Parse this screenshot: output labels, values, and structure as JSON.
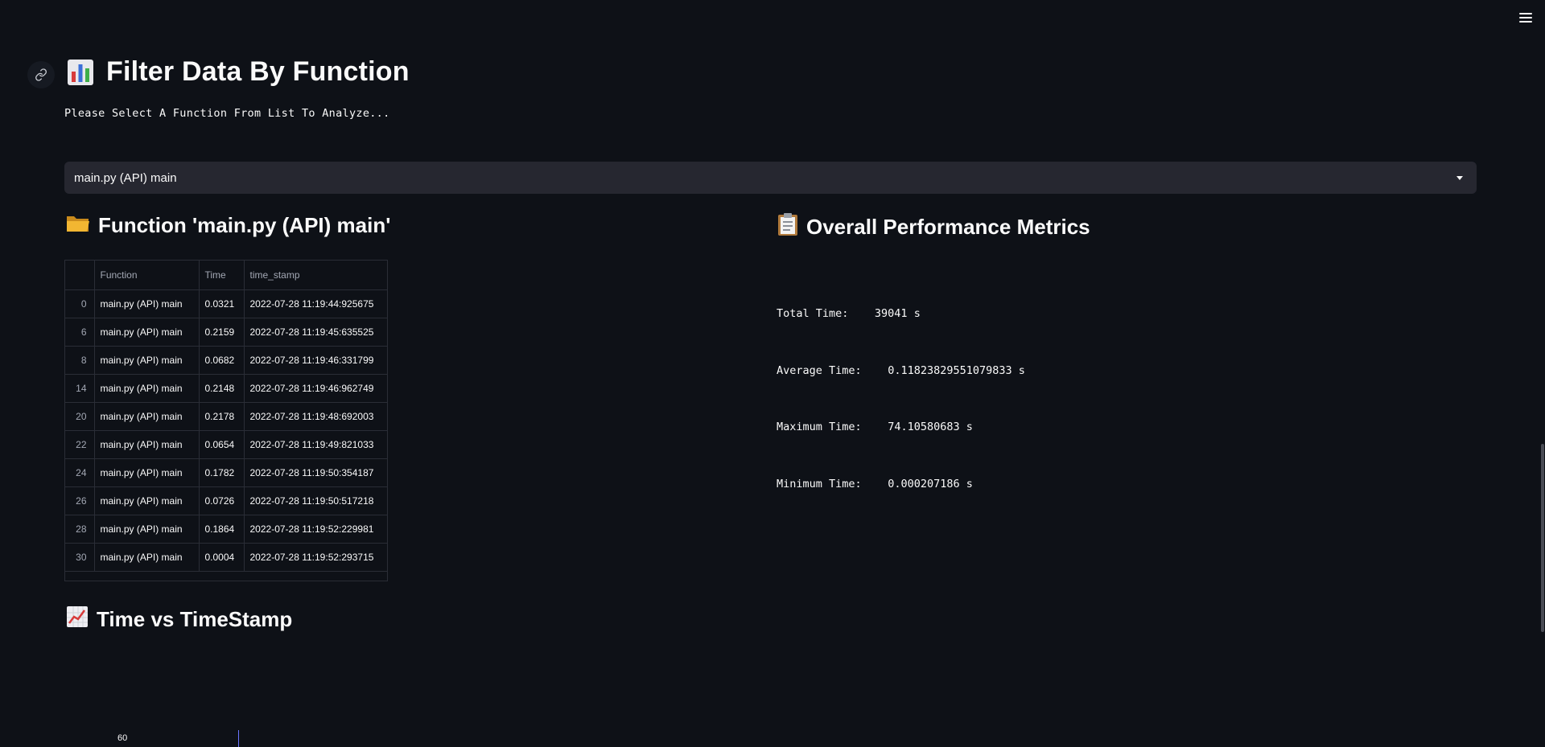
{
  "header": {
    "title": "Filter Data By Function",
    "title_emoji": "📊",
    "subtitle": "Please Select A Function From List To Analyze..."
  },
  "select": {
    "value": "main.py (API) main"
  },
  "function_section": {
    "emoji": "📂",
    "title": "Function 'main.py (API) main'"
  },
  "table": {
    "columns": [
      "",
      "Function",
      "Time",
      "time_stamp"
    ],
    "rows": [
      {
        "idx": "0",
        "function": "main.py (API)  main",
        "time": "0.0321",
        "time_stamp": "2022-07-28 11:19:44:925675"
      },
      {
        "idx": "6",
        "function": "main.py (API)  main",
        "time": "0.2159",
        "time_stamp": "2022-07-28 11:19:45:635525"
      },
      {
        "idx": "8",
        "function": "main.py (API)  main",
        "time": "0.0682",
        "time_stamp": "2022-07-28 11:19:46:331799"
      },
      {
        "idx": "14",
        "function": "main.py (API)  main",
        "time": "0.2148",
        "time_stamp": "2022-07-28 11:19:46:962749"
      },
      {
        "idx": "20",
        "function": "main.py (API)  main",
        "time": "0.2178",
        "time_stamp": "2022-07-28 11:19:48:692003"
      },
      {
        "idx": "22",
        "function": "main.py (API)  main",
        "time": "0.0654",
        "time_stamp": "2022-07-28 11:19:49:821033"
      },
      {
        "idx": "24",
        "function": "main.py (API)  main",
        "time": "0.1782",
        "time_stamp": "2022-07-28 11:19:50:354187"
      },
      {
        "idx": "26",
        "function": "main.py (API)  main",
        "time": "0.0726",
        "time_stamp": "2022-07-28 11:19:50:517218"
      },
      {
        "idx": "28",
        "function": "main.py (API)  main",
        "time": "0.1864",
        "time_stamp": "2022-07-28 11:19:52:229981"
      },
      {
        "idx": "30",
        "function": "main.py (API)  main",
        "time": "0.0004",
        "time_stamp": "2022-07-28 11:19:52:293715"
      }
    ]
  },
  "metrics_section": {
    "emoji": "📋",
    "title": "Overall Performance Metrics",
    "rows": [
      {
        "label": "Total Time:",
        "value": "39041 s"
      },
      {
        "label": "Average Time:",
        "value": "0.11823829551079833 s"
      },
      {
        "label": "Maximum Time:",
        "value": "74.10580683 s"
      },
      {
        "label": "Minimum Time:",
        "value": "0.000207186 s"
      }
    ]
  },
  "chart_section": {
    "emoji": "📈",
    "title": "Time vs TimeStamp",
    "y_tick": "60"
  },
  "colors": {
    "background": "#0e1117",
    "select_bg": "#262730",
    "text": "#fafafa",
    "chart_line": "#6b76ff"
  }
}
